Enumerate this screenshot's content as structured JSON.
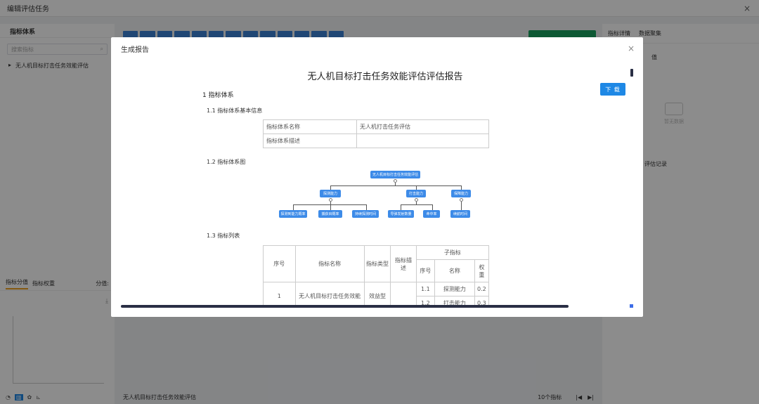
{
  "app": {
    "title": "编辑评估任务",
    "close": "×"
  },
  "left": {
    "header": "指标体系",
    "search_placeholder": "搜索指标",
    "search_icon": "search-icon",
    "tree_caret": "▸",
    "tree_item": "无人机目标打击任务效能评估",
    "tab_score": "指标分值",
    "tab_weight": "指标权重",
    "score_label": "分值:",
    "download_icon": "⤓",
    "footer_icons": [
      "◔",
      "▥",
      "✿",
      "⊾"
    ]
  },
  "center_footer": {
    "name": "无人机目标打击任务效能评估",
    "count": "10个指标",
    "prev": "|◀",
    "next": "▶|"
  },
  "right": {
    "tab1": "指标详情",
    "tab2": "数据聚集",
    "value": "值",
    "empty": "暂无数据",
    "records": "评估记录"
  },
  "modal": {
    "title": "生成报告",
    "close": "×",
    "download": "下 载",
    "report_title": "无人机目标打击任务效能评估评估报告",
    "s1": "1 指标体系",
    "s1_1": "1.1 指标体系基本信息",
    "info": [
      {
        "k": "指标体系名称",
        "v": "无人机打击任务评估"
      },
      {
        "k": "指标体系描述",
        "v": ""
      }
    ],
    "s1_2": "1.2 指标体系图",
    "tree": {
      "root": "无人机目标打击任务效能评估",
      "l1": [
        "探测能力",
        "打击能力",
        "保障能力"
      ],
      "l2": [
        "探测到能力概率",
        "捕获目概率",
        "持续探测时间",
        "导弹发射数量",
        "命中率",
        "续航时间"
      ]
    },
    "s1_3": "1.3 指标列表",
    "list": {
      "h_no": "序号",
      "h_name": "指标名称",
      "h_type": "指标类型",
      "h_desc": "指标描述",
      "h_sub": "子指标",
      "h_sub_no": "序号",
      "h_sub_name": "名称",
      "h_sub_weight": "权重",
      "row_no": "1",
      "row_name": "无人机目标打击任务效能",
      "row_type": "效益型",
      "sub1_no": "1.1",
      "sub1_name": "探测能力",
      "sub1_w": "0.2",
      "sub2_no": "1.2",
      "sub2_name": "打击能力",
      "sub2_w": "0.3"
    }
  }
}
